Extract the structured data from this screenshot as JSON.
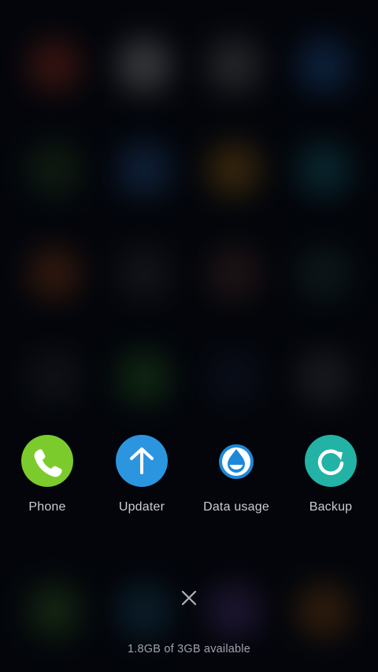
{
  "apps": [
    {
      "label": "Phone",
      "icon": "phone-icon",
      "color": "#7ccb2c"
    },
    {
      "label": "Updater",
      "icon": "arrow-up-icon",
      "color": "#2b95e0"
    },
    {
      "label": "Data usage",
      "icon": "water-drop-icon",
      "color": "#1e88d8"
    },
    {
      "label": "Backup",
      "icon": "backup-refresh-icon",
      "color": "#22b3a6"
    }
  ],
  "close": {
    "icon": "close-icon"
  },
  "memory": {
    "text": "1.8GB of 3GB available"
  },
  "colors": {
    "background": "#04060b",
    "label": "#c9ccd2",
    "memory_text": "#9ea3ab"
  }
}
